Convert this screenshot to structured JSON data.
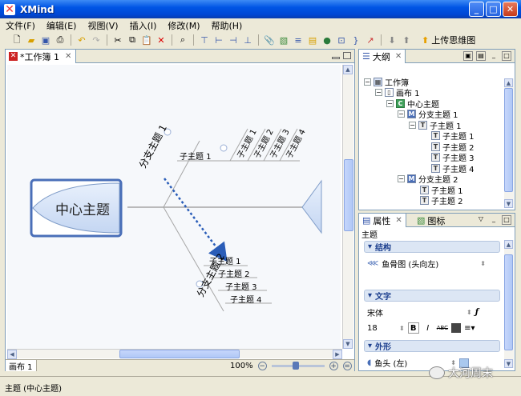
{
  "window": {
    "title": "XMind",
    "min": "_",
    "max": "□",
    "close": "✕"
  },
  "menu": [
    "文件(F)",
    "编辑(E)",
    "视图(V)",
    "插入(I)",
    "修改(M)",
    "帮助(H)"
  ],
  "toolbar": {
    "upload_label": "上传思维图"
  },
  "editor": {
    "tab_label": "*工作簿 1",
    "sheet_tab": "画布 1",
    "zoom": "100%"
  },
  "map": {
    "central": "中心主题",
    "branch1": "分支主题 1",
    "branch2": "分支主题 2",
    "branch1_children": [
      "子主题 1",
      "子主题 1",
      "子主题 2",
      "子主题 3",
      "子主题 4"
    ],
    "branch2_children": [
      "子主题 1",
      "子主题 2",
      "子主题 3",
      "子主题 4"
    ]
  },
  "outline": {
    "tab_label": "大纲",
    "nodes": [
      {
        "label": "工作簿",
        "type": "w"
      },
      {
        "label": "画布 1",
        "type": "b"
      },
      {
        "label": "中心主题",
        "type": "c"
      },
      {
        "label": "分支主题 1",
        "type": "m"
      },
      {
        "label": "子主题 1",
        "type": "t"
      },
      {
        "label": "子主题 1",
        "type": "t"
      },
      {
        "label": "子主题 2",
        "type": "t"
      },
      {
        "label": "子主题 3",
        "type": "t"
      },
      {
        "label": "子主题 4",
        "type": "t"
      },
      {
        "label": "分支主题 2",
        "type": "m"
      },
      {
        "label": "子主题 1",
        "type": "t"
      },
      {
        "label": "子主题 2",
        "type": "t"
      }
    ]
  },
  "properties": {
    "tab1": "属性",
    "tab2": "图标",
    "section": "主题",
    "structure_title": "结构",
    "structure_value": "鱼骨图 (头向左)",
    "text_title": "文字",
    "font_name": "宋体",
    "font_size": "18",
    "shape_title": "外形",
    "shape_value": "鱼头 (左)"
  },
  "statusbar": {
    "text": "主题 (中心主题)"
  },
  "watermark": "大河周末",
  "colors": {
    "titlebar": "#0055e5",
    "accent": "#1c3f8e",
    "central_border": "#4a6fb8"
  }
}
